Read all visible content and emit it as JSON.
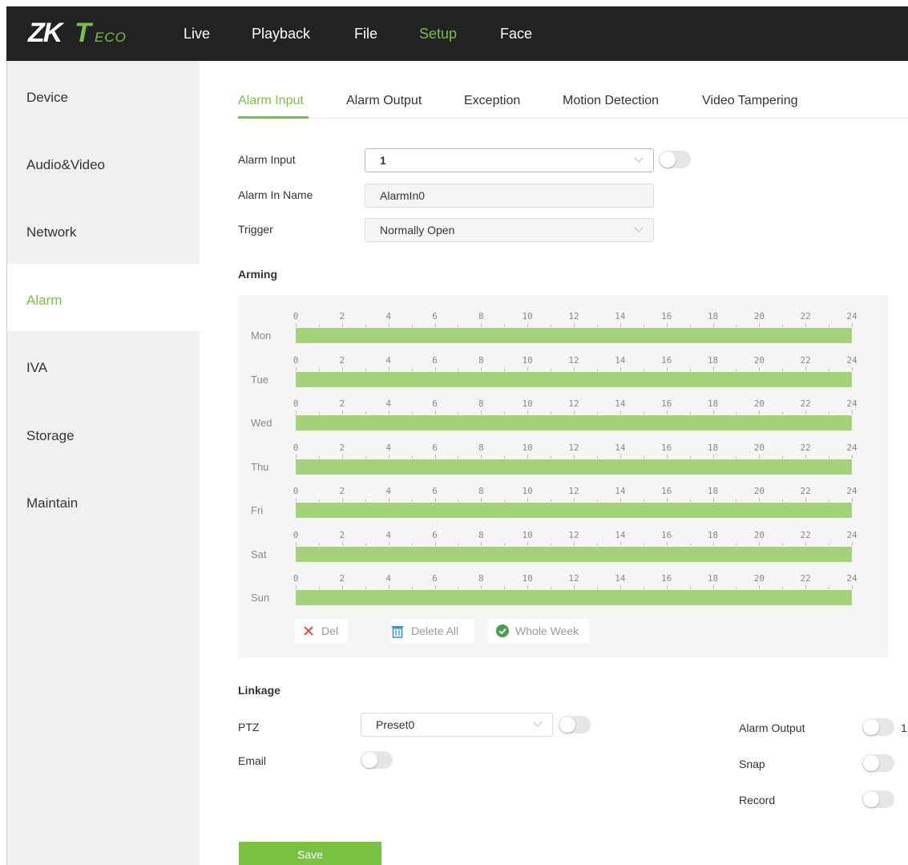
{
  "nav": {
    "logo": {
      "zk": "ZK",
      "t": "T",
      "eco": "ECO"
    },
    "items": [
      {
        "label": "Live"
      },
      {
        "label": "Playback"
      },
      {
        "label": "File"
      },
      {
        "label": "Setup"
      },
      {
        "label": "Face"
      }
    ],
    "active": "Setup"
  },
  "sidebar": {
    "items": [
      {
        "label": "Device"
      },
      {
        "label": "Audio&Video"
      },
      {
        "label": "Network"
      },
      {
        "label": "Alarm"
      },
      {
        "label": "IVA"
      },
      {
        "label": "Storage"
      },
      {
        "label": "Maintain"
      }
    ],
    "active": "Alarm"
  },
  "tabs": {
    "items": [
      {
        "label": "Alarm Input"
      },
      {
        "label": "Alarm Output"
      },
      {
        "label": "Exception"
      },
      {
        "label": "Motion Detection"
      },
      {
        "label": "Video Tampering"
      }
    ],
    "active": "Alarm Input"
  },
  "form": {
    "alarm_input": {
      "label": "Alarm Input",
      "value": "1",
      "enabled": false
    },
    "alarm_in_name": {
      "label": "Alarm In Name",
      "value": "AlarmIn0"
    },
    "trigger": {
      "label": "Trigger",
      "value": "Normally Open"
    }
  },
  "arming": {
    "title": "Arming",
    "ticks": [
      "0",
      "2",
      "4",
      "6",
      "8",
      "10",
      "12",
      "14",
      "16",
      "18",
      "20",
      "22",
      "24"
    ],
    "days": [
      {
        "label": "Mon",
        "start": 0,
        "end": 24
      },
      {
        "label": "Tue",
        "start": 0,
        "end": 24
      },
      {
        "label": "Wed",
        "start": 0,
        "end": 24
      },
      {
        "label": "Thu",
        "start": 0,
        "end": 24
      },
      {
        "label": "Fri",
        "start": 0,
        "end": 24
      },
      {
        "label": "Sat",
        "start": 0,
        "end": 24
      },
      {
        "label": "Sun",
        "start": 0,
        "end": 24
      }
    ],
    "buttons": {
      "del": "Del",
      "delete_all": "Delete All",
      "whole_week": "Whole Week"
    }
  },
  "linkage": {
    "title": "Linkage",
    "ptz": {
      "label": "PTZ",
      "value": "Preset0",
      "enabled": false
    },
    "email": {
      "label": "Email",
      "enabled": false
    },
    "alarm_output": {
      "label": "Alarm Output",
      "enabled": false,
      "suffix": "1"
    },
    "snap": {
      "label": "Snap",
      "enabled": false
    },
    "record": {
      "label": "Record",
      "enabled": false
    }
  },
  "save_label": "Save",
  "colors": {
    "accent": "#7ac143",
    "topbar": "#222222",
    "bar": "#a3d27a",
    "del_red": "#e8463b",
    "trash_blue": "#2c8fd6"
  }
}
